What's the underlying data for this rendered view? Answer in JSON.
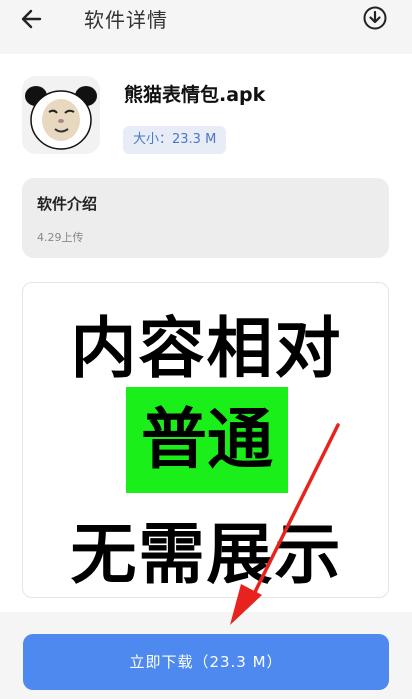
{
  "header": {
    "title": "软件详情",
    "back_icon": "back-arrow-icon",
    "download_icon": "download-circle-icon"
  },
  "app": {
    "name": "熊猫表情包.apk",
    "size_label": "大小：23.3 M",
    "icon": "panda-meme-icon"
  },
  "intro": {
    "title": "软件介绍",
    "upload_date": "4.29上传"
  },
  "banner": {
    "line1": "内容相对",
    "line2": "普通",
    "line3": "无需展示",
    "highlight_color": "#1aef1a"
  },
  "footer": {
    "download_label": "立即下载（23.3 M）",
    "button_color": "#4e89f0"
  },
  "annotation": {
    "arrow_color": "#e8221c"
  }
}
